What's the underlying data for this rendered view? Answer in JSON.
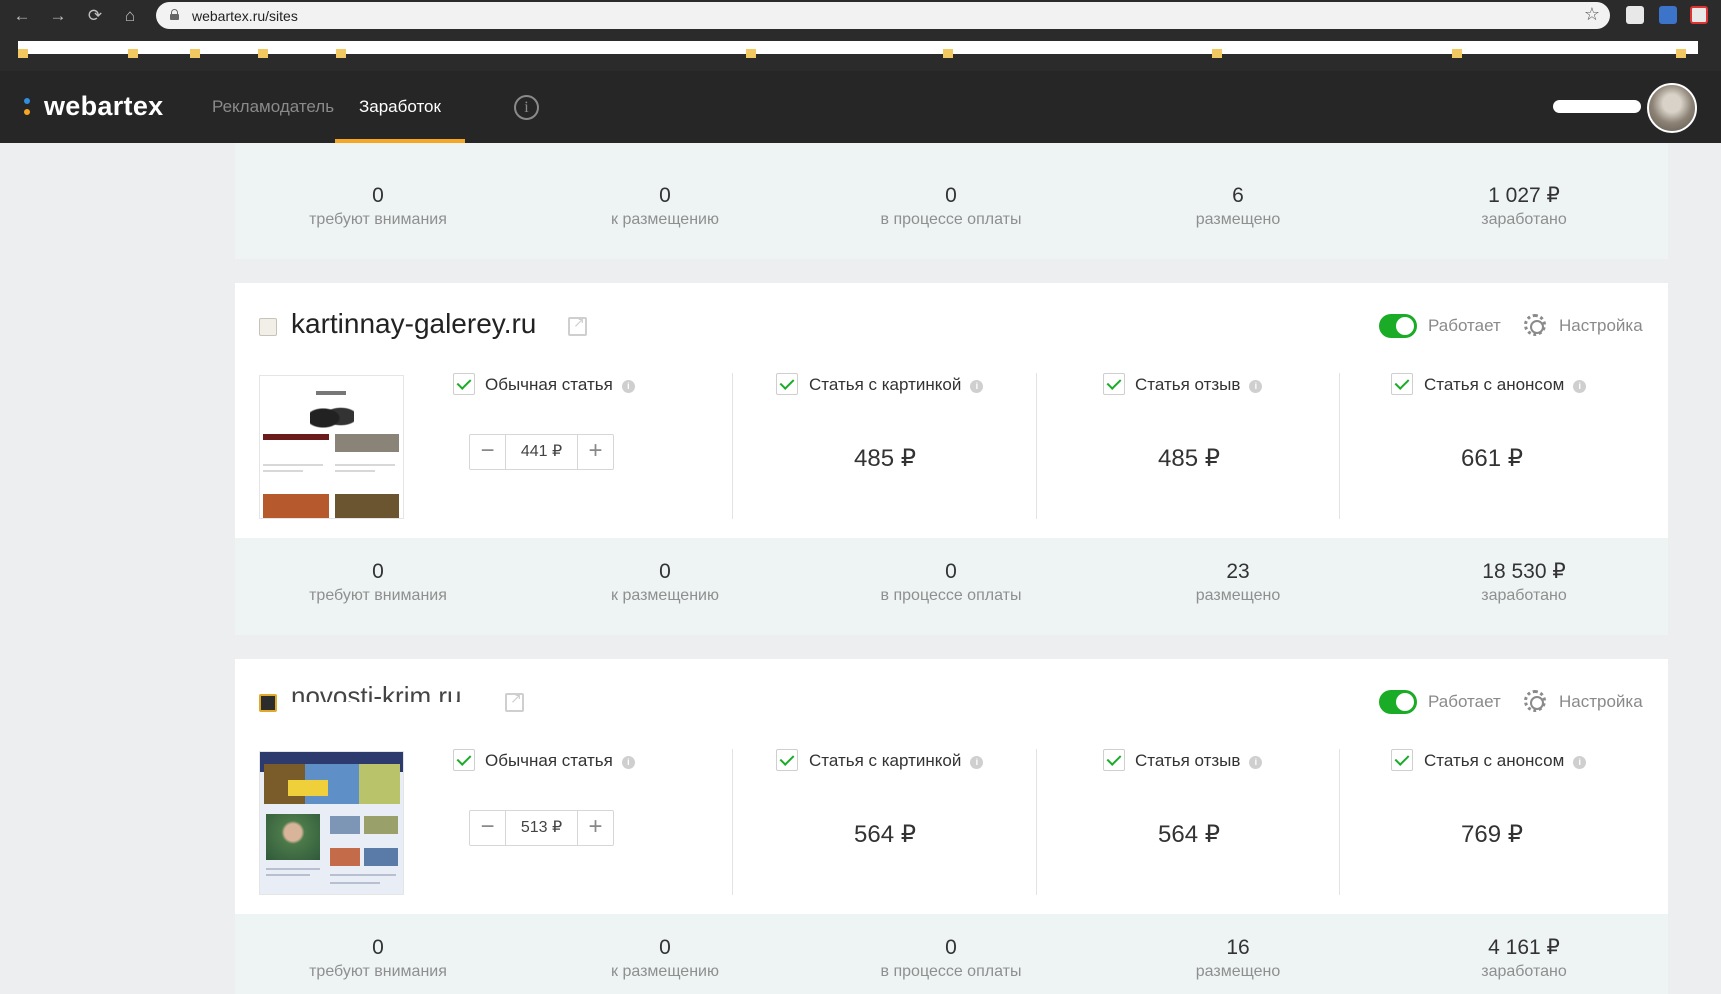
{
  "browser": {
    "url": "webartex.ru/sites"
  },
  "header": {
    "logo": "webartex",
    "colors": {
      "logo_dot_blue": "#2f8fe0",
      "logo_dot_orange": "#f5a623",
      "accent": "#f5a623"
    },
    "tabs": [
      {
        "label": "Рекламодатель",
        "active": false
      },
      {
        "label": "Заработок",
        "active": true
      }
    ]
  },
  "stat_labels": [
    "требуют внимания",
    "к размещению",
    "в процессе оплаты",
    "размещено",
    "заработано"
  ],
  "top_stats": [
    "0",
    "0",
    "0",
    "6",
    "1 027 ₽"
  ],
  "sites": [
    {
      "name": "kartinnay-galerey.ru",
      "status": "Работает",
      "settings": "Настройка",
      "types": [
        {
          "label": "Обычная статья",
          "checked": true,
          "price": "441 ₽",
          "editable": true
        },
        {
          "label": "Статья с картинкой",
          "checked": true,
          "price": "485 ₽"
        },
        {
          "label": "Статья отзыв",
          "checked": true,
          "price": "485 ₽"
        },
        {
          "label": "Статья с анонсом",
          "checked": true,
          "price": "661 ₽"
        }
      ],
      "stats": [
        "0",
        "0",
        "0",
        "23",
        "18 530 ₽"
      ]
    },
    {
      "name": "novosti-krim.ru",
      "status": "Работает",
      "settings": "Настройка",
      "types": [
        {
          "label": "Обычная статья",
          "checked": true,
          "price": "513 ₽",
          "editable": true
        },
        {
          "label": "Статья с картинкой",
          "checked": true,
          "price": "564 ₽"
        },
        {
          "label": "Статья отзыв",
          "checked": true,
          "price": "564 ₽"
        },
        {
          "label": "Статья с анонсом",
          "checked": true,
          "price": "769 ₽"
        }
      ],
      "stats": [
        "0",
        "0",
        "0",
        "16",
        "4 161 ₽"
      ]
    }
  ]
}
